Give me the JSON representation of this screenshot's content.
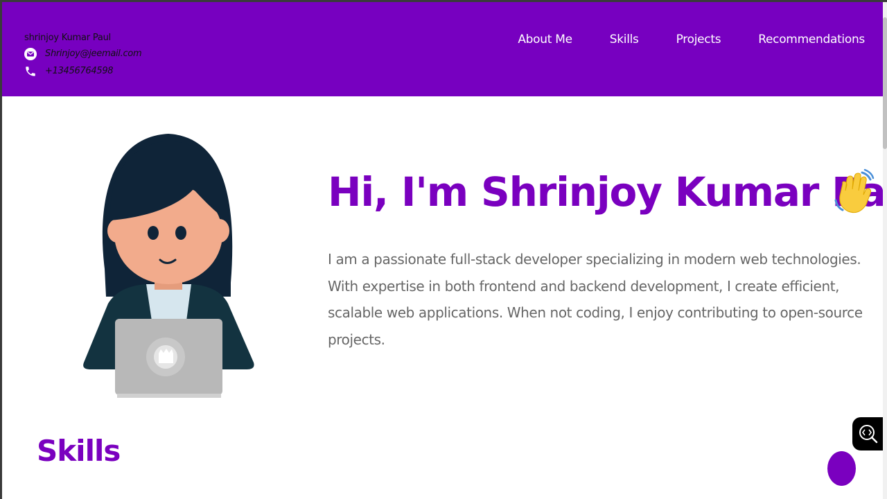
{
  "header": {
    "name": "shrinjoy Kumar Paul",
    "email": "Shrinjoy@jeemail.com",
    "phone": "+13456764598",
    "icons": {
      "email": "email-icon",
      "phone": "phone-icon"
    }
  },
  "nav": {
    "items": [
      "About Me",
      "Skills",
      "Projects",
      "Recommendations"
    ]
  },
  "hero": {
    "title": "Hi, I'm Shrinjoy Kumar Paul!",
    "description": "I am a passionate full-stack developer specializing in modern web technologies. With expertise in both frontend and backend development, I create efficient, scalable web applications. When not coding, I enjoy contributing to open-source projects."
  },
  "sections": {
    "skills_title": "Skills"
  },
  "colors": {
    "brand": "#7700c0",
    "accent_text": "#7a00bf",
    "body_text": "#666666"
  }
}
